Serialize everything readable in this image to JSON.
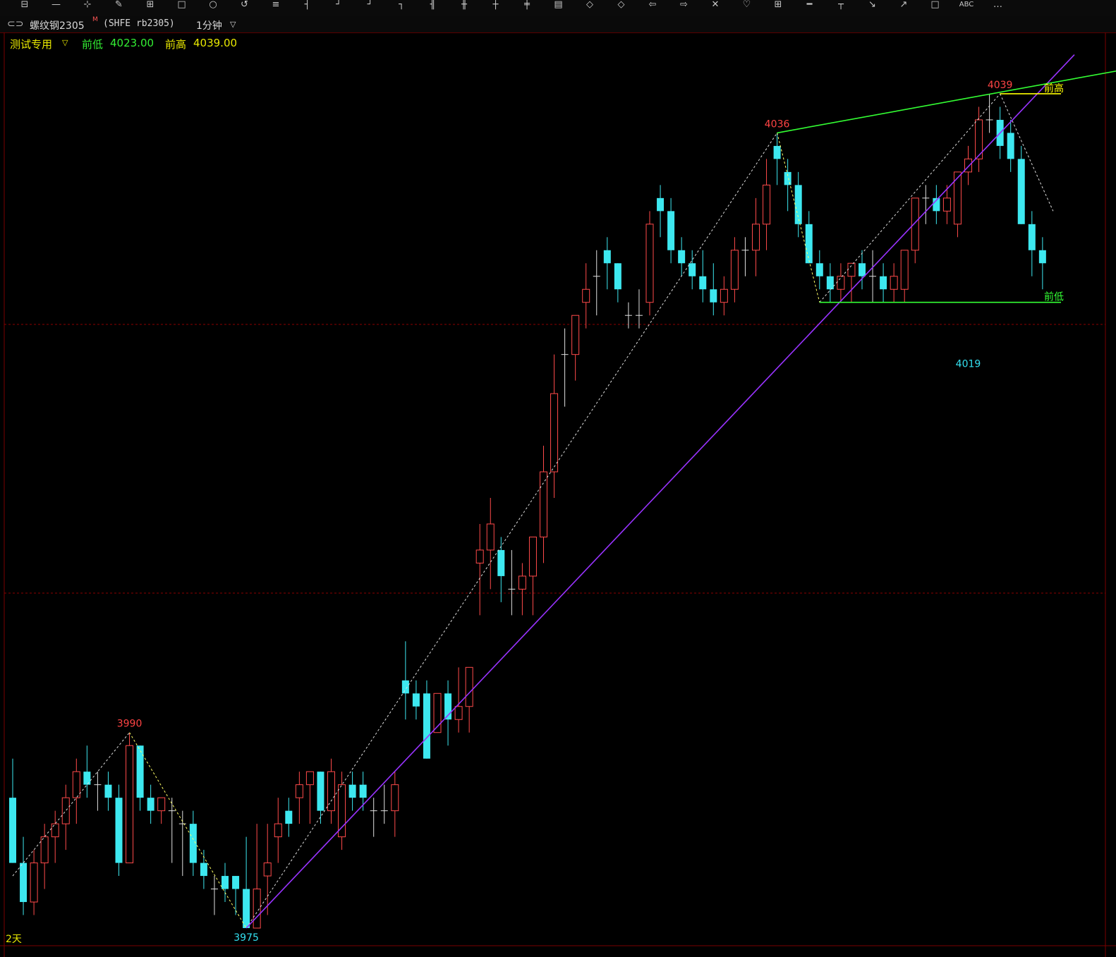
{
  "toolbar": {
    "icons": [
      "grid-icon",
      "line-tool-icon",
      "cursor-icon",
      "brush-icon",
      "table-icon",
      "rect-icon",
      "circle-icon",
      "cycle-icon",
      "fib-icon",
      "tick-icon",
      "min1-icon",
      "min5-icon",
      "min15-icon",
      "hour-icon",
      "day-icon",
      "week-icon",
      "month-icon",
      "quarter-icon",
      "diamond-left-icon",
      "diamond-right-icon",
      "arrow-left-icon",
      "arrow-right-icon",
      "cross-icon",
      "heart-icon",
      "layout-icon",
      "minus-icon",
      "pin-icon",
      "arrow-down-right-icon",
      "arrow-up-right-icon",
      "square-icon",
      "abc-icon",
      "more-icon"
    ],
    "abc_label": "ABC",
    "more_label": "…"
  },
  "title": {
    "name": "螺纹钢2305",
    "marker": "M",
    "code": "(SHFE rb2305)",
    "period": "1分钟"
  },
  "info": {
    "indicator": "测试专用",
    "low_label": "前低",
    "low_value": "4023.00",
    "high_label": "前高",
    "high_value": "4039.00"
  },
  "colors": {
    "up": "#ff4a4a",
    "down": "#3de8f0",
    "doji": "#e0e0e0",
    "prev_high": "#ffff00",
    "prev_low": "#33ff33",
    "trend_up": "#9933ff",
    "trend_high": "#33ff33",
    "red_label": "#ff4444",
    "cyan_label": "#33e0f0",
    "zigzag": "#dddddd",
    "zigzag_yellow": "#ffff66",
    "grid_red": "#8b0000"
  },
  "footer": {
    "days_label": "2天"
  },
  "chart_data": {
    "type": "candlestick",
    "ylim": [
      3975,
      4041
    ],
    "x_count": 98,
    "candles": [
      [
        3985,
        3988,
        3980,
        3980
      ],
      [
        3980,
        3982,
        3976,
        3977
      ],
      [
        3977,
        3981,
        3976,
        3980
      ],
      [
        3980,
        3983,
        3978,
        3982
      ],
      [
        3982,
        3984,
        3980,
        3983
      ],
      [
        3983,
        3986,
        3981,
        3985
      ],
      [
        3985,
        3988,
        3983,
        3987
      ],
      [
        3987,
        3989,
        3985,
        3986
      ],
      [
        3986,
        3987,
        3984,
        3986
      ],
      [
        3986,
        3987,
        3984,
        3985
      ],
      [
        3985,
        3986,
        3979,
        3980
      ],
      [
        3980,
        3990,
        3980,
        3989
      ],
      [
        3989,
        3989,
        3984,
        3985
      ],
      [
        3985,
        3986,
        3983,
        3984
      ],
      [
        3984,
        3985,
        3983,
        3985
      ],
      [
        3984,
        3985,
        3980,
        3984
      ],
      [
        3983,
        3984,
        3979,
        3983
      ],
      [
        3983,
        3984,
        3979,
        3980
      ],
      [
        3980,
        3981,
        3978,
        3979
      ],
      [
        3978,
        3979,
        3976,
        3978
      ],
      [
        3979,
        3980,
        3977,
        3978
      ],
      [
        3979,
        3979,
        3976,
        3978
      ],
      [
        3978,
        3982,
        3975,
        3975
      ],
      [
        3975,
        3983,
        3975,
        3978
      ],
      [
        3979,
        3983,
        3976,
        3980
      ],
      [
        3982,
        3985,
        3980,
        3983
      ],
      [
        3984,
        3985,
        3982,
        3983
      ],
      [
        3985,
        3987,
        3983,
        3986
      ],
      [
        3986,
        3987,
        3983,
        3987
      ],
      [
        3987,
        3987,
        3983,
        3984
      ],
      [
        3984,
        3988,
        3983,
        3987
      ],
      [
        3982,
        3987,
        3981,
        3986
      ],
      [
        3986,
        3987,
        3984,
        3985
      ],
      [
        3986,
        3987,
        3984,
        3985
      ],
      [
        3984,
        3985,
        3982,
        3984
      ],
      [
        3984,
        3986,
        3983,
        3984
      ],
      [
        3984,
        3987,
        3982,
        3986
      ],
      [
        3994,
        3997,
        3991,
        3993
      ],
      [
        3993,
        3994,
        3991,
        3992
      ],
      [
        3993,
        3994,
        3988,
        3988
      ],
      [
        3990,
        3993,
        3990,
        3993
      ],
      [
        3993,
        3994,
        3989,
        3991
      ],
      [
        3991,
        3995,
        3990,
        3992
      ],
      [
        3992,
        3995,
        3990,
        3995
      ],
      [
        4003,
        4006,
        3999,
        4004
      ],
      [
        4004,
        4008,
        4001,
        4006
      ],
      [
        4004,
        4005,
        4000,
        4002
      ],
      [
        4001,
        4004,
        3999,
        4001
      ],
      [
        4001,
        4003,
        3999,
        4002
      ],
      [
        4002,
        4004,
        3999,
        4005
      ],
      [
        4005,
        4012,
        4003,
        4010
      ],
      [
        4010,
        4019,
        4008,
        4016
      ],
      [
        4019,
        4021,
        4015,
        4019
      ],
      [
        4019,
        4022,
        4017,
        4022
      ],
      [
        4023,
        4026,
        4021,
        4024
      ],
      [
        4025,
        4027,
        4022,
        4025
      ],
      [
        4027,
        4028,
        4024,
        4026
      ],
      [
        4026,
        4026,
        4023,
        4024
      ],
      [
        4022,
        4023,
        4021,
        4022
      ],
      [
        4022,
        4024,
        4021,
        4022
      ],
      [
        4023,
        4030,
        4022,
        4029
      ],
      [
        4031,
        4032,
        4028,
        4030
      ],
      [
        4030,
        4031,
        4026,
        4027
      ],
      [
        4027,
        4028,
        4025,
        4026
      ],
      [
        4026,
        4027,
        4024,
        4025
      ],
      [
        4025,
        4027,
        4023,
        4024
      ],
      [
        4024,
        4026,
        4022,
        4023
      ],
      [
        4023,
        4025,
        4022,
        4024
      ],
      [
        4024,
        4028,
        4023,
        4027
      ],
      [
        4027,
        4028,
        4025,
        4027
      ],
      [
        4027,
        4031,
        4025,
        4029
      ],
      [
        4029,
        4034,
        4027,
        4032
      ],
      [
        4035,
        4036,
        4032,
        4034
      ],
      [
        4033,
        4034,
        4030,
        4032
      ],
      [
        4032,
        4033,
        4028,
        4029
      ],
      [
        4029,
        4030,
        4026,
        4026
      ],
      [
        4026,
        4027,
        4024,
        4025
      ],
      [
        4025,
        4026,
        4023,
        4024
      ],
      [
        4024,
        4026,
        4023,
        4025
      ],
      [
        4025,
        4026,
        4023,
        4026
      ],
      [
        4026,
        4027,
        4024,
        4025
      ],
      [
        4025,
        4027,
        4023,
        4025
      ],
      [
        4025,
        4026,
        4023,
        4024
      ],
      [
        4024,
        4026,
        4023,
        4025
      ],
      [
        4024,
        4027,
        4023,
        4027
      ],
      [
        4027,
        4031,
        4026,
        4031
      ],
      [
        4031,
        4032,
        4029,
        4031
      ],
      [
        4031,
        4032,
        4029,
        4030
      ],
      [
        4030,
        4032,
        4029,
        4031
      ],
      [
        4029,
        4033,
        4028,
        4033
      ],
      [
        4033,
        4035,
        4032,
        4034
      ],
      [
        4034,
        4038,
        4033,
        4037
      ],
      [
        4037,
        4039,
        4036,
        4037
      ],
      [
        4037,
        4038,
        4034,
        4035
      ],
      [
        4036,
        4037,
        4033,
        4034
      ],
      [
        4034,
        4035,
        4029,
        4029
      ],
      [
        4029,
        4030,
        4025,
        4027
      ],
      [
        4027,
        4028,
        4024,
        4026
      ]
    ],
    "annotations": [
      {
        "text": "3990",
        "color": "red"
      },
      {
        "text": "3975",
        "color": "cyan"
      },
      {
        "text": "4036",
        "color": "red"
      },
      {
        "text": "4039",
        "color": "red"
      },
      {
        "text": "4019",
        "color": "cyan"
      }
    ],
    "hlines": [
      {
        "label": "前高",
        "value": 4039
      },
      {
        "label": "前低",
        "value": 4023
      }
    ]
  }
}
